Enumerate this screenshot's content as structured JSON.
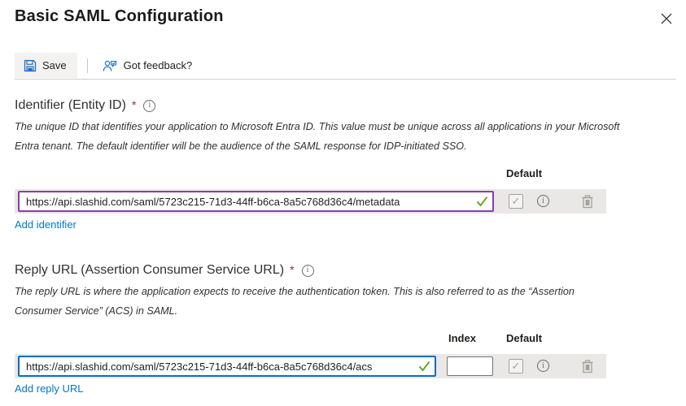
{
  "panel": {
    "title": "Basic SAML Configuration"
  },
  "toolbar": {
    "save_label": "Save",
    "feedback_label": "Got feedback?"
  },
  "identifier_section": {
    "title": "Identifier (Entity ID)",
    "required_mark": "*",
    "description": "The unique ID that identifies your application to Microsoft Entra ID. This value must be unique across all applications in your Microsoft Entra tenant. The default identifier will be the audience of the SAML response for IDP-initiated SSO.",
    "columns": {
      "default": "Default"
    },
    "row": {
      "url_value": "https://api.slashid.com/saml/5723c215-71d3-44ff-b6ca-8a5c768d36c4/metadata",
      "valid": true,
      "default_checked": true
    },
    "add_link": "Add identifier"
  },
  "reply_section": {
    "title": "Reply URL (Assertion Consumer Service URL)",
    "required_mark": "*",
    "description": "The reply URL is where the application expects to receive the authentication token. This is also referred to as the “Assertion Consumer Service” (ACS) in SAML.",
    "columns": {
      "index": "Index",
      "default": "Default"
    },
    "row": {
      "url_value": "https://api.slashid.com/saml/5723c215-71d3-44ff-b6ca-8a5c768d36c4/acs",
      "index_value": "",
      "valid": true,
      "default_checked": true
    },
    "add_link": "Add reply URL"
  },
  "colors": {
    "link_blue": "#0078d4",
    "focus_border_blue": "#0f6cbd",
    "dirty_border_purple": "#8a3fa5",
    "valid_green": "#57a300",
    "required_red": "#a4262c",
    "row_background": "#e9e8e6"
  }
}
